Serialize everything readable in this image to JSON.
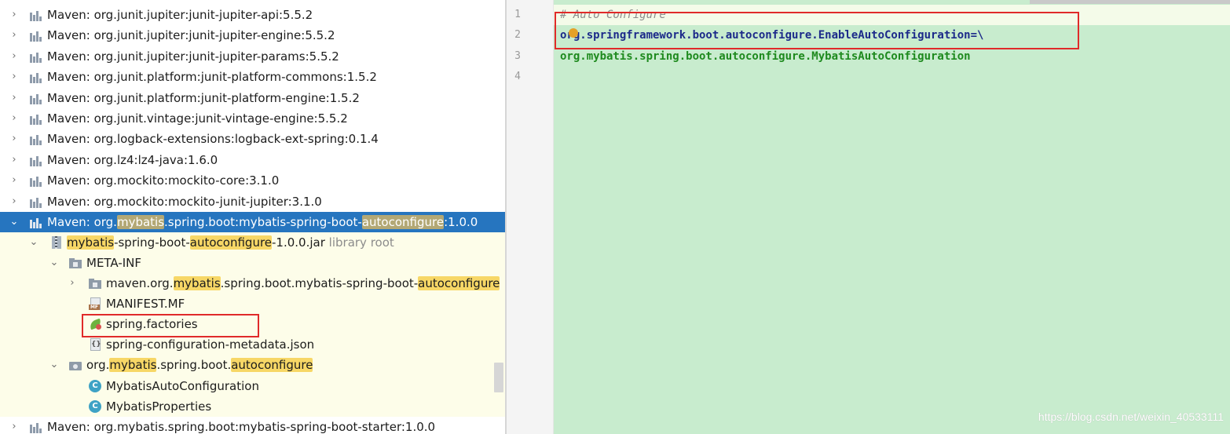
{
  "tree": {
    "rows": [
      {
        "arrow": "›",
        "label": "Maven: org.junit.jupiter:junit-jupiter-api:5.5.2"
      },
      {
        "arrow": "›",
        "label": "Maven: org.junit.jupiter:junit-jupiter-engine:5.5.2"
      },
      {
        "arrow": "›",
        "label": "Maven: org.junit.jupiter:junit-jupiter-params:5.5.2"
      },
      {
        "arrow": "›",
        "label": "Maven: org.junit.platform:junit-platform-commons:1.5.2"
      },
      {
        "arrow": "›",
        "label": "Maven: org.junit.platform:junit-platform-engine:1.5.2"
      },
      {
        "arrow": "›",
        "label": "Maven: org.junit.vintage:junit-vintage-engine:5.5.2"
      },
      {
        "arrow": "›",
        "label": "Maven: org.logback-extensions:logback-ext-spring:0.1.4"
      },
      {
        "arrow": "›",
        "label": "Maven: org.lz4:lz4-java:1.6.0"
      },
      {
        "arrow": "›",
        "label": "Maven: org.mockito:mockito-core:3.1.0"
      },
      {
        "arrow": "›",
        "label": "Maven: org.mockito:mockito-junit-jupiter:3.1.0"
      }
    ],
    "selected": {
      "arrow": "⌄",
      "parts": [
        "Maven: org.",
        "mybatis",
        ".spring.boot:mybatis-spring-boot-",
        "autoconfigure",
        ":1.0.0"
      ]
    },
    "jar": {
      "arrow": "⌄",
      "parts": [
        "mybatis",
        "-spring-boot-",
        "autoconfigure",
        "-1.0.0.jar"
      ],
      "hint": "library root"
    },
    "meta_inf": {
      "arrow": "⌄",
      "label": "META-INF"
    },
    "maven_pkg": {
      "arrow": "›",
      "parts": [
        "maven.org.",
        "mybatis",
        ".spring.boot.mybatis-spring-boot-",
        "autoconfigure"
      ]
    },
    "manifest": {
      "label": "MANIFEST.MF",
      "badge": "MF"
    },
    "spring_factories": {
      "label": "spring.factories"
    },
    "metadata_json": {
      "label": "spring-configuration-metadata.json",
      "badge": "{}"
    },
    "package": {
      "arrow": "⌄",
      "parts": [
        "org.",
        "mybatis",
        ".spring.boot.",
        "autoconfigure"
      ]
    },
    "classes": [
      {
        "label": "MybatisAutoConfiguration",
        "badge": "C"
      },
      {
        "label": "MybatisProperties",
        "badge": "C"
      }
    ],
    "last_row": {
      "arrow": "›",
      "label": "Maven: org.mybatis.spring.boot:mybatis-spring-boot-starter:1.0.0"
    }
  },
  "editor": {
    "line_numbers": [
      "1",
      "2",
      "3",
      "4"
    ],
    "line1": "# Auto Configure",
    "line2_key": "org.springframework.boot.autoconfigure.EnableAutoConfiguration",
    "line2_eq": "=\\",
    "line3": "org.mybatis.spring.boot.autoconfigure.MybatisAutoConfiguration"
  },
  "watermark": "https://blog.csdn.net/weixin_40533111",
  "colors": {
    "selection": "#2675bf",
    "match_highlight": "#f7d766",
    "editor_bg": "#c8ecce",
    "annotation_red": "#e02a2a"
  }
}
